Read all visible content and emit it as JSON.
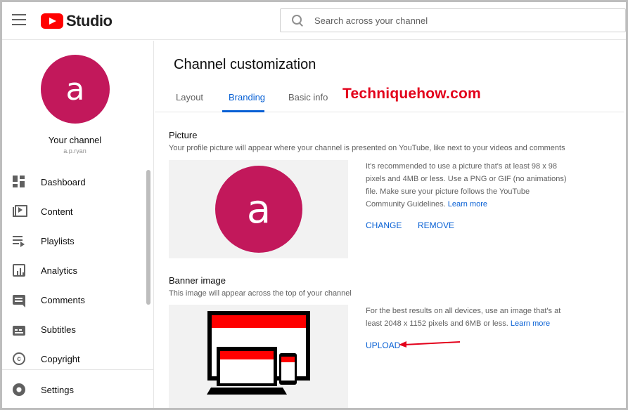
{
  "header": {
    "logo_text": "Studio",
    "search_placeholder": "Search across your channel"
  },
  "sidebar": {
    "avatar_letter": "a",
    "channel_label": "Your channel",
    "channel_handle": "a.p.ryan",
    "items": [
      {
        "label": "Dashboard",
        "icon": "dashboard-icon"
      },
      {
        "label": "Content",
        "icon": "content-icon"
      },
      {
        "label": "Playlists",
        "icon": "playlists-icon"
      },
      {
        "label": "Analytics",
        "icon": "analytics-icon"
      },
      {
        "label": "Comments",
        "icon": "comments-icon"
      },
      {
        "label": "Subtitles",
        "icon": "subtitles-icon"
      },
      {
        "label": "Copyright",
        "icon": "copyright-icon"
      }
    ],
    "settings_label": "Settings",
    "copyright_glyph": "c"
  },
  "main": {
    "title": "Channel customization",
    "tabs": [
      {
        "label": "Layout",
        "active": false
      },
      {
        "label": "Branding",
        "active": true
      },
      {
        "label": "Basic info",
        "active": false
      }
    ],
    "watermark": "Techniquehow.com",
    "picture": {
      "title": "Picture",
      "description": "Your profile picture will appear where your channel is presented on YouTube, like next to your videos and comments",
      "avatar_letter": "a",
      "info": "It's recommended to use a picture that's at least 98 x 98 pixels and 4MB or less. Use a PNG or GIF (no animations) file. Make sure your picture follows the YouTube Community Guidelines.",
      "learn_more": "Learn more",
      "change_label": "CHANGE",
      "remove_label": "REMOVE"
    },
    "banner": {
      "title": "Banner image",
      "description": "This image will appear across the top of your channel",
      "info": "For the best results on all devices, use an image that's at least 2048 x 1152 pixels and 6MB or less.",
      "learn_more": "Learn more",
      "upload_label": "UPLOAD"
    }
  },
  "colors": {
    "accent": "#065fd4",
    "avatar": "#c2185b",
    "watermark": "#e3001b",
    "youtube_red": "#ff0000"
  }
}
